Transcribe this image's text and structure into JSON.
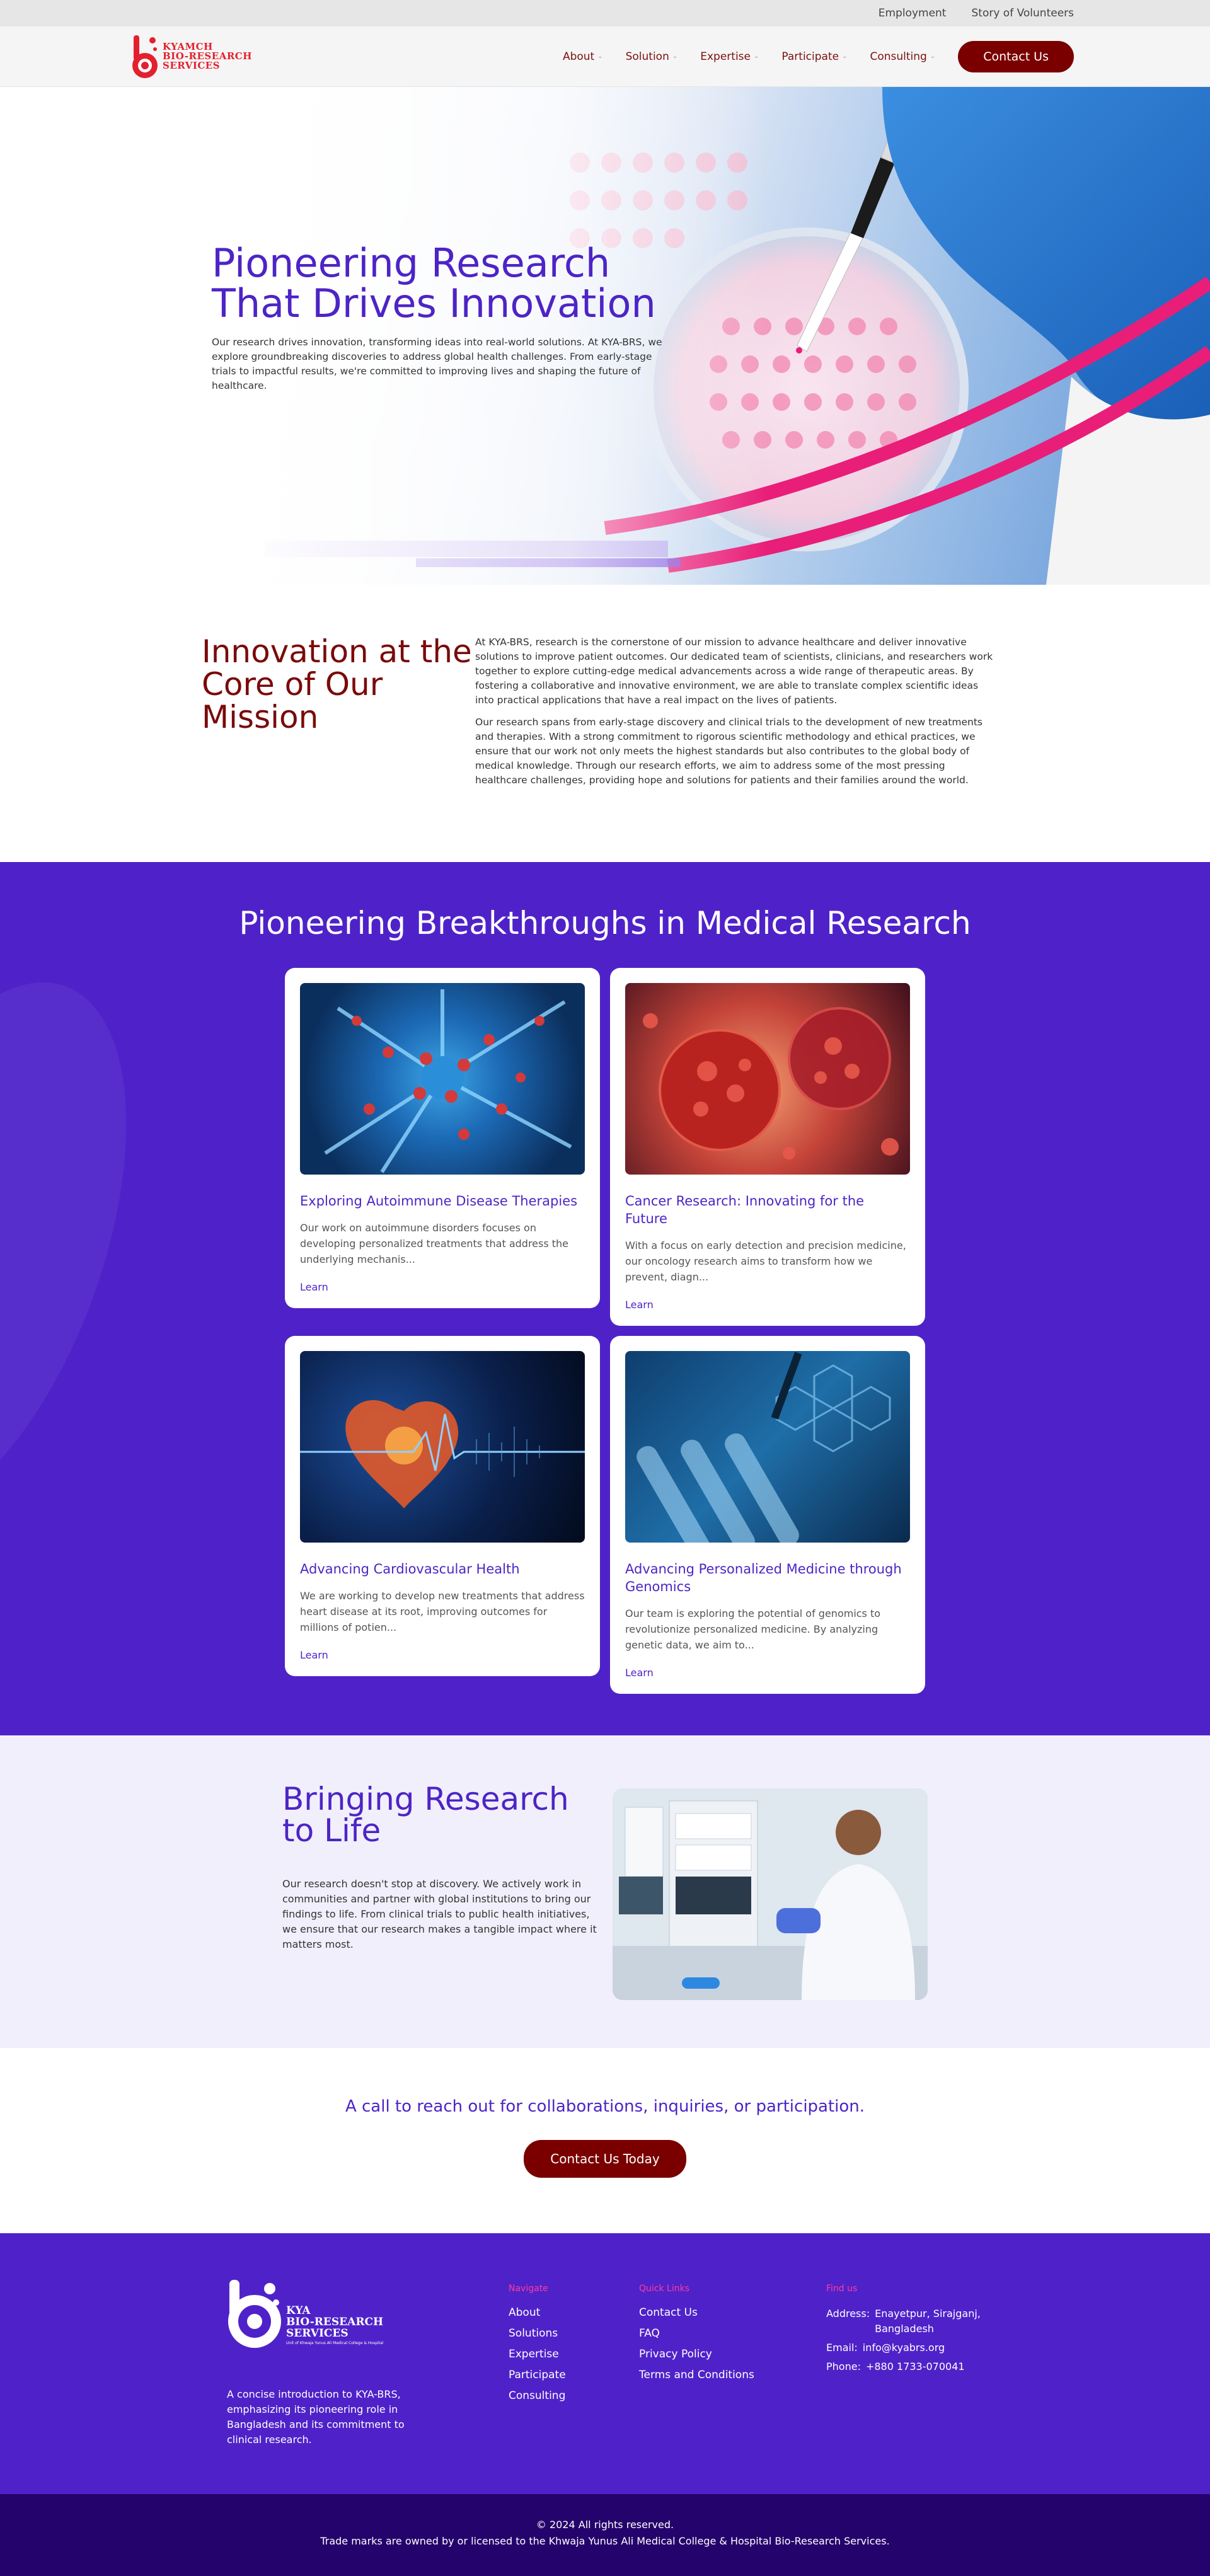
{
  "topbar": {
    "employment": "Employment",
    "volunteers": "Story of Volunteers"
  },
  "header": {
    "logo_text": [
      "KYAMCH",
      "BIO-RESEARCH",
      "SERVICES"
    ],
    "nav": [
      {
        "label": "About"
      },
      {
        "label": "Solution"
      },
      {
        "label": "Expertise"
      },
      {
        "label": "Participate"
      },
      {
        "label": "Consulting"
      }
    ],
    "contact_label": "Contact Us"
  },
  "hero": {
    "title_line1": "Pioneering Research",
    "title_line2": "That Drives Innovation",
    "description": "Our research drives innovation, transforming ideas into real-world solutions. At KYA-BRS, we explore groundbreaking discoveries to address global health challenges. From early-stage trials to impactful results, we're committed to improving lives and shaping the future of healthcare."
  },
  "mission": {
    "title": "Innovation at the Core of Our Mission",
    "p1": "At KYA-BRS, research is the cornerstone of our mission to advance healthcare and deliver innovative solutions to improve patient outcomes. Our dedicated team of scientists, clinicians, and researchers work together to explore cutting-edge medical advancements across a wide range of therapeutic areas. By fostering a collaborative and innovative environment, we are able to translate complex scientific ideas into practical applications that have a real impact on the lives of patients.",
    "p2": "Our research spans from early-stage discovery and clinical trials to the development of new treatments and therapies. With a strong commitment to rigorous scientific methodology and ethical practices, we ensure that our work not only meets the highest standards but also contributes to the global body of medical knowledge. Through our research efforts, we aim to address some of the most pressing healthcare challenges, providing hope and solutions for patients and their families around the world."
  },
  "breakthroughs": {
    "title": "Pioneering Breakthroughs in Medical Research",
    "cards": [
      {
        "title": "Exploring Autoimmune Disease Therapies",
        "desc": "Our work on autoimmune disorders focuses on developing personalized treatments that address the underlying mechanis...",
        "link": "Learn"
      },
      {
        "title": "Cancer Research: Innovating for the Future",
        "desc": "With a focus on early detection and precision medicine, our oncology research aims to transform how we prevent, diagn...",
        "link": "Learn"
      },
      {
        "title": "Advancing Cardiovascular Health",
        "desc": "We are working to develop new treatments that address heart disease at its root, improving outcomes for millions of potien...",
        "link": "Learn"
      },
      {
        "title": "Advancing Personalized Medicine through Genomics",
        "desc": "Our team is exploring the potential of genomics to revolutionize personalized medicine. By analyzing genetic data, we aim to...",
        "link": "Learn"
      }
    ]
  },
  "research": {
    "title": "Bringing Research to Life",
    "desc": "Our research doesn't stop at discovery. We actively work in communities and partner with global institutions to bring our findings to life. From clinical trials to public health initiatives, we ensure that our research makes a tangible impact where it matters most."
  },
  "cta": {
    "text": "A call to reach out for collaborations, inquiries, or participation.",
    "button": "Contact Us Today"
  },
  "footer": {
    "logo_text": [
      "KYA",
      "BIO-RESEARCH",
      "SERVICES"
    ],
    "logo_sub": "Unit of Khwaja Yunus Ali Medical College & Hospital",
    "about": "A concise introduction to KYA-BRS, emphasizing its pioneering role in Bangladesh and its commitment to clinical research.",
    "navigate": {
      "heading": "Navigate",
      "items": [
        "About",
        "Solutions",
        "Expertise",
        "Participate",
        "Consulting"
      ]
    },
    "quick": {
      "heading": "Quick Links",
      "items": [
        "Contact Us",
        "FAQ",
        "Privacy Policy",
        "Terms and Conditions"
      ]
    },
    "find": {
      "heading": "Find us",
      "address_label": "Address:",
      "address": "Enayetpur, Sirajganj, Bangladesh",
      "email_label": "Email:",
      "email": "info@kyabrs.org",
      "phone_label": "Phone:",
      "phone": "+880 1733-070041"
    }
  },
  "copyright": {
    "line1": "© 2024  All rights reserved.",
    "line2": "Trade marks are owned by or licensed to the Khwaja Yunus Ali Medical College & Hospital Bio-Research Services."
  },
  "colors": {
    "purple": "#4f22c9",
    "maroon": "#7a0000",
    "pink": "#e91e78",
    "dark_navy": "#25036c"
  }
}
